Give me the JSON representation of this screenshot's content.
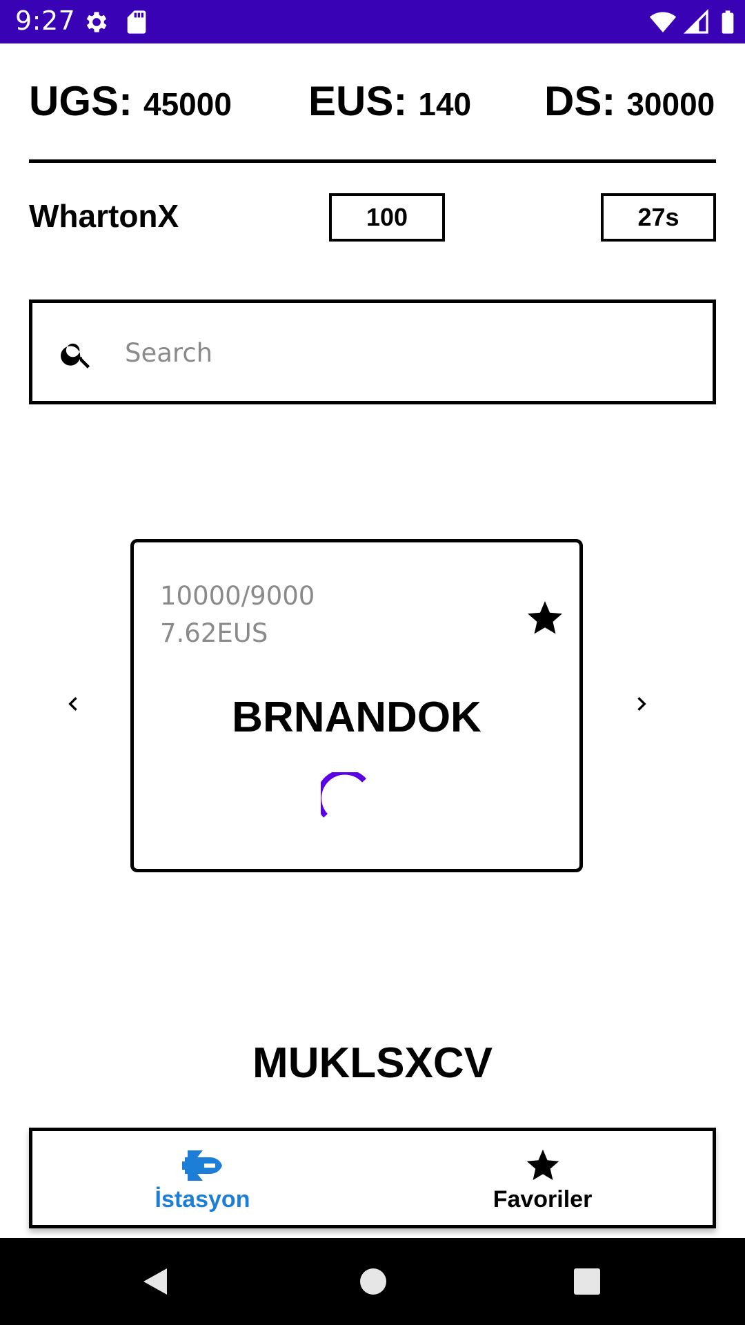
{
  "status_bar": {
    "time": "9:27",
    "icons": [
      "gear-icon",
      "sd-card-icon",
      "wifi-icon",
      "signal-icon",
      "battery-icon"
    ],
    "background_color": "#3a02b5"
  },
  "stats": {
    "ugs": {
      "label": "UGS:",
      "value": "45000"
    },
    "eus": {
      "label": "EUS:",
      "value": "140"
    },
    "ds": {
      "label": "DS:",
      "value": "30000"
    }
  },
  "user": {
    "name": "WhartonX",
    "score": "100",
    "timer": "27s"
  },
  "search": {
    "placeholder": "Search",
    "value": "",
    "icon": "search-icon"
  },
  "station_card": {
    "capacity": "10000/9000",
    "price": "7.62EUS",
    "name": "BRNANDOK",
    "favorite_icon": "star-icon",
    "spinner_color": "#5b00e6"
  },
  "next_station": {
    "name": "MUKLSXCV"
  },
  "bottom_nav": {
    "items": [
      {
        "label": "İstasyon",
        "icon": "space-shuttle-icon",
        "active": true,
        "color": "#1c7ed6"
      },
      {
        "label": "Favoriler",
        "icon": "star-icon",
        "active": false,
        "color": "#000000"
      }
    ]
  },
  "system_nav": {
    "buttons": [
      "back-icon",
      "home-icon",
      "recents-icon"
    ]
  }
}
